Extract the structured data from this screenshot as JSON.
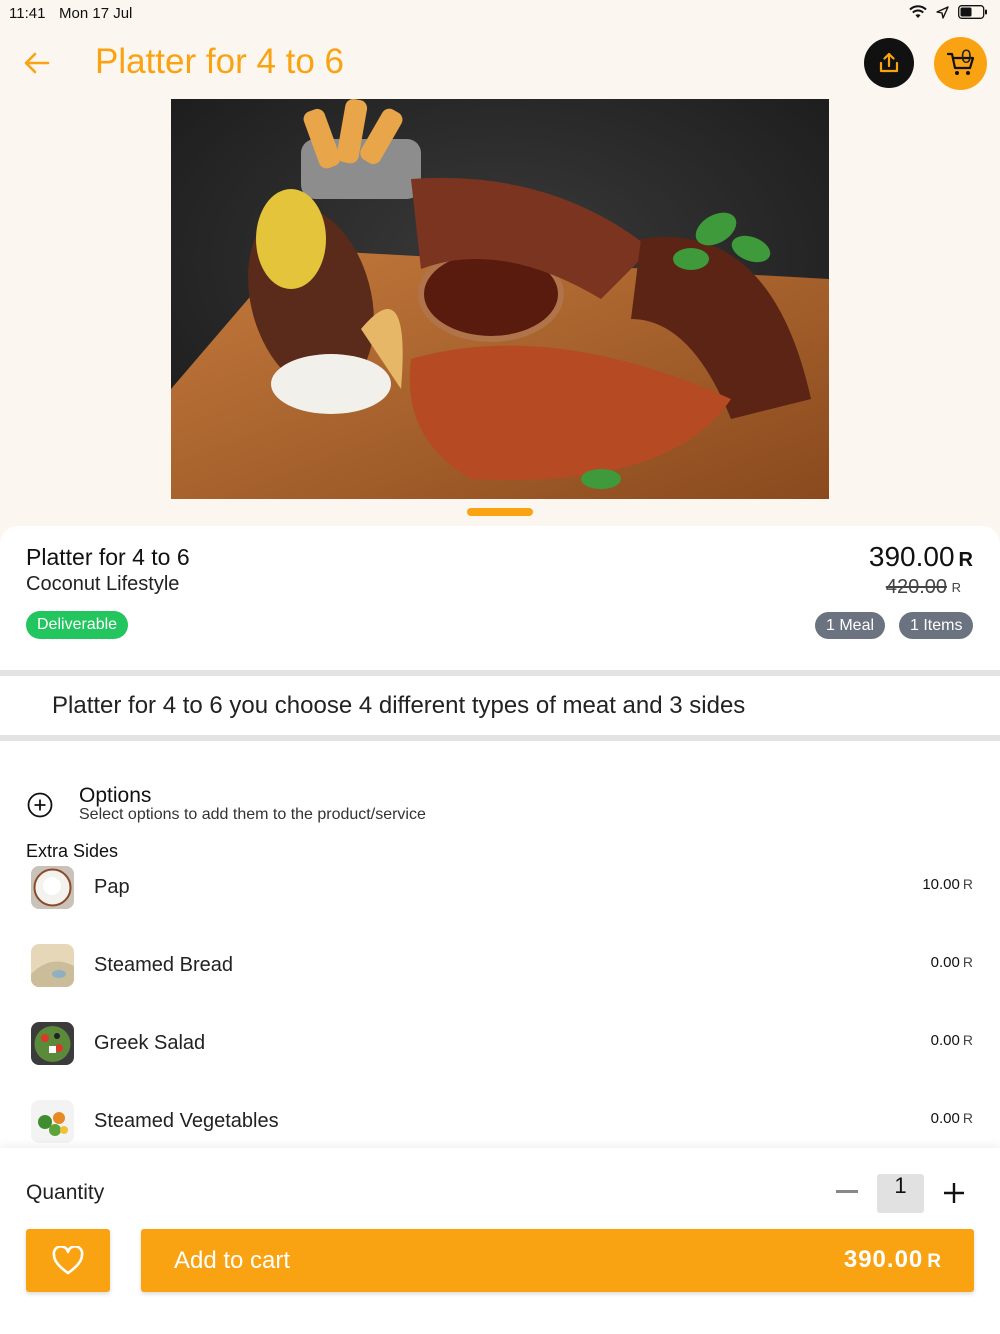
{
  "status_bar": {
    "time": "11:41",
    "date": "Mon 17 Jul"
  },
  "header": {
    "title": "Platter for 4 to 6",
    "cart_count": "0"
  },
  "product": {
    "name": "Platter for 4 to 6",
    "vendor": "Coconut Lifestyle",
    "badge": "Deliverable",
    "price": "390.00",
    "price_unit": "R",
    "old_price": "420.00",
    "old_price_unit": "R",
    "tags": [
      "1 Meal",
      "1 Items"
    ],
    "description": "Platter for 4 to 6 you choose 4 different types of meat and 3 sides"
  },
  "options": {
    "title": "Options",
    "subtitle": "Select options to add them to the product/service",
    "group_title": "Extra Sides",
    "items": [
      {
        "name": "Pap",
        "price": "10.00",
        "unit": "R"
      },
      {
        "name": "Steamed Bread",
        "price": "0.00",
        "unit": "R"
      },
      {
        "name": "Greek Salad",
        "price": "0.00",
        "unit": "R"
      },
      {
        "name": "Steamed Vegetables",
        "price": "0.00",
        "unit": "R"
      }
    ]
  },
  "footer": {
    "quantity_label": "Quantity",
    "quantity": "1",
    "add_label": "Add to cart",
    "add_price": "390.00",
    "add_unit": "R"
  },
  "colors": {
    "accent": "#f9a313",
    "deliverable": "#22c55e",
    "tag": "#6b7280",
    "background_top": "#fbf6f0"
  },
  "icons": [
    "arrow-left-icon",
    "share-icon",
    "cart-icon",
    "plus-circle-icon",
    "heart-icon",
    "minus-icon",
    "plus-icon",
    "wifi-icon",
    "location-icon",
    "battery-icon"
  ]
}
